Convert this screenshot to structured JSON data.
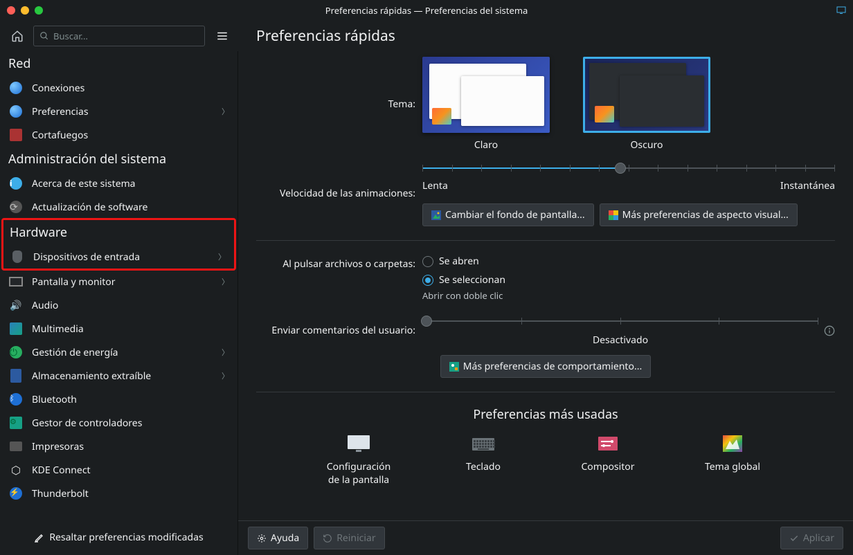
{
  "window": {
    "title": "Preferencias rápidas — Preferencias del sistema"
  },
  "toolbar": {
    "search_placeholder": "Buscar...",
    "page_title": "Preferencias rápidas"
  },
  "sidebar": {
    "sections": [
      {
        "title": "Red",
        "items": [
          {
            "id": "connections",
            "label": "Conexiones",
            "icon": "globe"
          },
          {
            "id": "net-prefs",
            "label": "Preferencias",
            "icon": "globe",
            "chevron": true
          },
          {
            "id": "firewall",
            "label": "Cortafuegos",
            "icon": "firewall"
          }
        ]
      },
      {
        "title": "Administración del sistema",
        "items": [
          {
            "id": "about",
            "label": "Acerca de este sistema",
            "icon": "info"
          },
          {
            "id": "updates",
            "label": "Actualización de software",
            "icon": "update"
          }
        ]
      },
      {
        "title": "Hardware",
        "highlight": true,
        "items": [
          {
            "id": "input-devices",
            "label": "Dispositivos de entrada",
            "icon": "mouse",
            "chevron": true,
            "inside_highlight": true
          }
        ]
      },
      {
        "title": "",
        "items": [
          {
            "id": "display",
            "label": "Pantalla y monitor",
            "icon": "display",
            "chevron": true
          },
          {
            "id": "audio",
            "label": "Audio",
            "icon": "audio"
          },
          {
            "id": "multimedia",
            "label": "Multimedia",
            "icon": "media"
          },
          {
            "id": "power",
            "label": "Gestión de energía",
            "icon": "power",
            "chevron": true
          },
          {
            "id": "storage",
            "label": "Almacenamiento extraíble",
            "icon": "storage",
            "chevron": true
          },
          {
            "id": "bluetooth",
            "label": "Bluetooth",
            "icon": "bluetooth"
          },
          {
            "id": "drivers",
            "label": "Gestor de controladores",
            "icon": "driver"
          },
          {
            "id": "printers",
            "label": "Impresoras",
            "icon": "printer"
          },
          {
            "id": "kdeconnect",
            "label": "KDE Connect",
            "icon": "kdeconnect"
          },
          {
            "id": "thunderbolt",
            "label": "Thunderbolt",
            "icon": "thunderbolt"
          }
        ]
      }
    ],
    "footer": {
      "highlight_modified": "Resaltar preferencias modificadas"
    }
  },
  "main": {
    "theme_label": "Tema:",
    "themes": {
      "light": "Claro",
      "dark": "Oscuro",
      "selected": "dark"
    },
    "anim_label": "Velocidad de las animaciones:",
    "anim_slow": "Lenta",
    "anim_fast": "Instantánea",
    "anim_value": 0.48,
    "change_wallpaper": "Cambiar el fondo de pantalla...",
    "more_visual": "Más preferencias de aspecto visual...",
    "click_label": "Al pulsar archivos o carpetas:",
    "click_open": "Se abren",
    "click_select": "Se seleccionan",
    "click_selected": "select",
    "double_click_hint": "Abrir con doble clic",
    "feedback_label": "Enviar comentarios del usuario:",
    "feedback_status": "Desactivado",
    "feedback_value": 0.0,
    "more_behaviour": "Más preferencias de comportamiento...",
    "most_used_title": "Preferencias más usadas",
    "most_used": [
      {
        "id": "display-config",
        "label": "Configuración de la pantalla",
        "icon": "monitor"
      },
      {
        "id": "keyboard",
        "label": "Teclado",
        "icon": "keyboard"
      },
      {
        "id": "compositor",
        "label": "Compositor",
        "icon": "compositor"
      },
      {
        "id": "global-theme",
        "label": "Tema global",
        "icon": "theme"
      }
    ]
  },
  "footer": {
    "help": "Ayuda",
    "reset": "Reiniciar",
    "apply": "Aplicar"
  }
}
